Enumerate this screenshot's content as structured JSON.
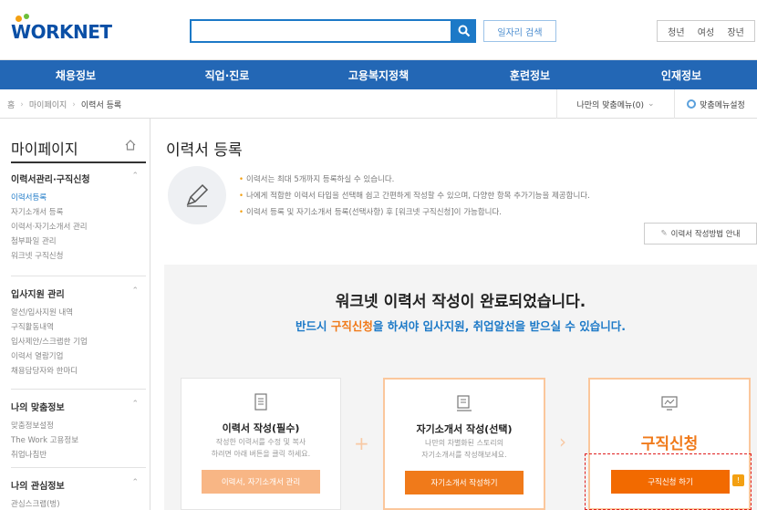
{
  "header": {
    "logo_text": "ORKNET",
    "search_placeholder": "",
    "job_search_label": "일자리 검색",
    "user_tabs": [
      "청년",
      "여성",
      "장년"
    ]
  },
  "gnb": [
    "채용정보",
    "직업·진로",
    "고용복지정책",
    "훈련정보",
    "인재정보"
  ],
  "breadcrumb": {
    "home": "홈",
    "level1": "마이페이지",
    "current": "이력서 등록"
  },
  "my_menu": {
    "label": "나만의 맞춤메뉴(0)",
    "setting_label": "맞춤메뉴설정"
  },
  "sidebar": {
    "title": "마이페이지",
    "groups": [
      {
        "title": "이력서관리·구직신청",
        "items": [
          "이력서등록",
          "자기소개서 등록",
          "이력서·자기소개서 관리",
          "첨부파일 관리",
          "워크넷 구직신청"
        ]
      },
      {
        "title": "입사지원 관리",
        "items": [
          "알선/입사지원 내역",
          "구직활동내역",
          "입사제안/스크랩한 기업",
          "이력서 열람기업",
          "채용담당자와 한마디"
        ]
      },
      {
        "title": "나의 맞춤정보",
        "items": [
          "맞춤정보설정",
          "The Work 고용정보",
          "취업나침반"
        ]
      },
      {
        "title": "나의 관심정보",
        "items": [
          "관심스크랩(벙)"
        ]
      }
    ]
  },
  "main": {
    "title": "이력서 등록",
    "notices": [
      "이력서는 최대 5개까지 등록하실 수 있습니다.",
      "나에게 적합한 이력서 타입을 선택해 쉽고 간편하게 작성할 수 있으며, 다양한 항목 추가기능을 제공합니다.",
      "이력서 등록 및 자기소개서 등록(선택사항) 후 [워크넷 구직신청]이 가능합니다."
    ],
    "guide_button": "이력서 작성방법 안내",
    "done_title": "워크넷 이력서 작성이 완료되었습니다.",
    "done_sub_prefix": "반드시 ",
    "done_sub_highlight": "구직신청",
    "done_sub_suffix": "을 하셔야 입사지원, 취업알선을 받으실 수 있습니다."
  },
  "cards": [
    {
      "title": "이력서 작성(필수)",
      "desc": [
        "작성한 이력서를 수정 및 복사",
        "하려면 아래 버튼을 클릭 하세요."
      ],
      "button": "이력서, 자기소개서 관리"
    },
    {
      "title": "자기소개서 작성(선택)",
      "desc": [
        "나만의 차별화된 스토리의",
        "자기소개서를 작성해보세요."
      ],
      "button": "자기소개서 작성하기"
    },
    {
      "big": "구직신청",
      "button": "구직신청 하기"
    }
  ],
  "colors": {
    "brand_blue": "#2367b5",
    "accent_orange": "#f07a1a",
    "link_blue": "#1c79c7"
  }
}
